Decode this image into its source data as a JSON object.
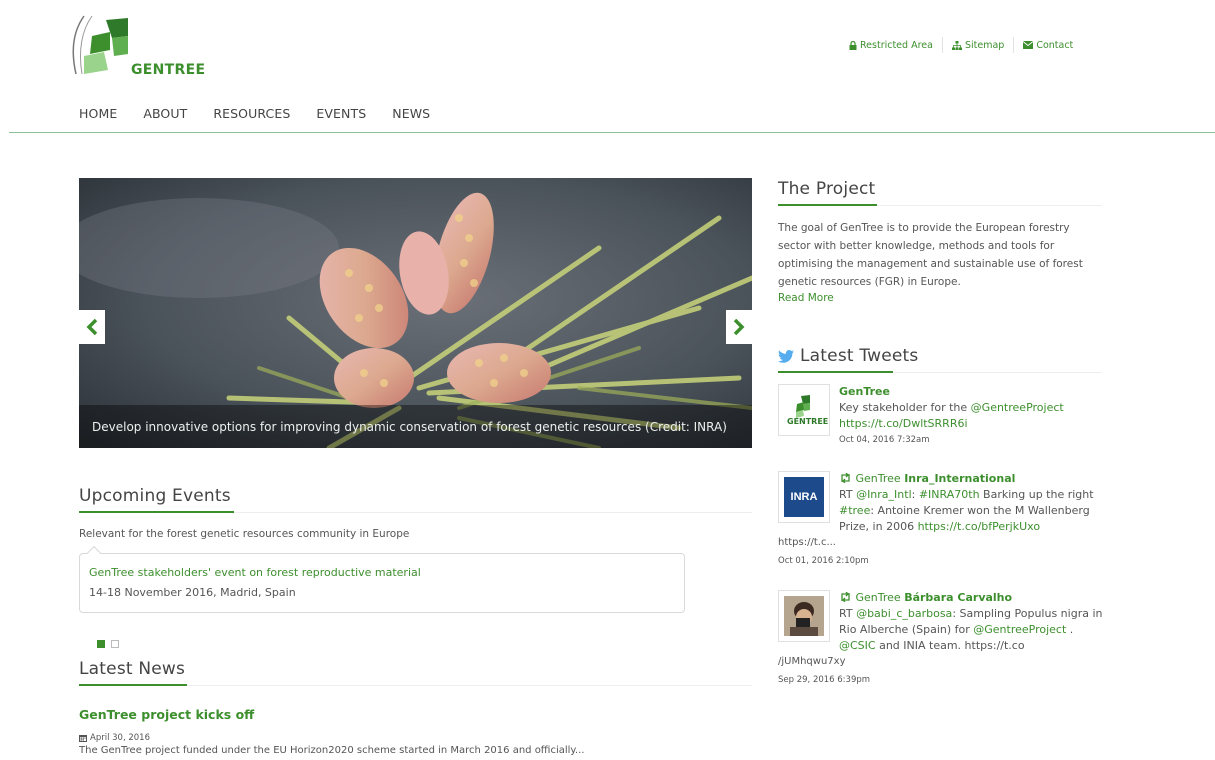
{
  "brand": {
    "name": "GENTREE",
    "green": "#3d8f2e",
    "dark_green": "#2e7a2a",
    "light_green": "#9ad38b"
  },
  "topbar": {
    "restricted": "Restricted Area",
    "sitemap": "Sitemap",
    "contact": "Contact"
  },
  "nav": {
    "items": [
      "HOME",
      "ABOUT",
      "RESOURCES",
      "EVENTS",
      "NEWS"
    ]
  },
  "slider": {
    "caption": "Develop innovative options for improving dynamic conservation of forest genetic resources (Credit: INRA)"
  },
  "project": {
    "title": "The Project",
    "text": "The goal of GenTree is to provide the European forestry sector with better knowledge, methods and tools for optimising the management and sustainable use of forest genetic resources (FGR) in Europe.",
    "read_more": "Read More"
  },
  "events": {
    "title": "Upcoming Events",
    "subtitle": "Relevant for the forest genetic resources community in Europe",
    "items": [
      {
        "title": "GenTree stakeholders' event on forest reproductive material",
        "date": "14-18 November 2016, Madrid, Spain"
      }
    ]
  },
  "news": {
    "title": "Latest News",
    "items": [
      {
        "title": "GenTree project kicks off",
        "date": "April 30, 2016",
        "excerpt": "The GenTree project funded under the EU Horizon2020 scheme started in March 2016 and officially..."
      }
    ]
  },
  "tweets": {
    "title": "Latest Tweets",
    "items": [
      {
        "author": "GenTree",
        "avatar_label": "GENTREE",
        "text_1": "Key stakeholder for the ",
        "mention_1": "@GentreeProject",
        "link": "https://t.co/DwltSRRR6i",
        "time": "Oct 04, 2016 7:32am"
      },
      {
        "rt_by": "GenTree",
        "author": "Inra_International",
        "avatar_label": "INRA",
        "text_1": "RT ",
        "mention_1": "@Inra_Intl",
        "text_2": ": ",
        "hashtag_1": "#INRA70th",
        "text_3": " Barking up the right ",
        "hashtag_2": "#tree",
        "text_4": ": Antoine Kremer won the M Wallenberg Prize, in 2006 ",
        "link": "https://t.co/bfPerjkUxo",
        "extra": "https://t.c...",
        "time": "Oct 01, 2016 2:10pm"
      },
      {
        "rt_by": "GenTree",
        "author": "Bárbara Carvalho",
        "text_1": "RT ",
        "mention_1": "@babi_c_barbosa",
        "text_2": ": Sampling Populus nigra in Rio Alberche (Spain) for ",
        "mention_2": "@GentreeProject",
        "text_3": " . ",
        "mention_3": "@CSIC",
        "text_4": " and INIA team. https://t.co",
        "extra": "/jUMhqwu7xy",
        "time": "Sep 29, 2016 6:39pm"
      }
    ]
  },
  "icons": [
    "lock-icon",
    "sitemap-icon",
    "envelope-icon",
    "twitter-bird-icon",
    "retweet-icon",
    "calendar-icon",
    "chevron-left-icon",
    "chevron-right-icon"
  ]
}
